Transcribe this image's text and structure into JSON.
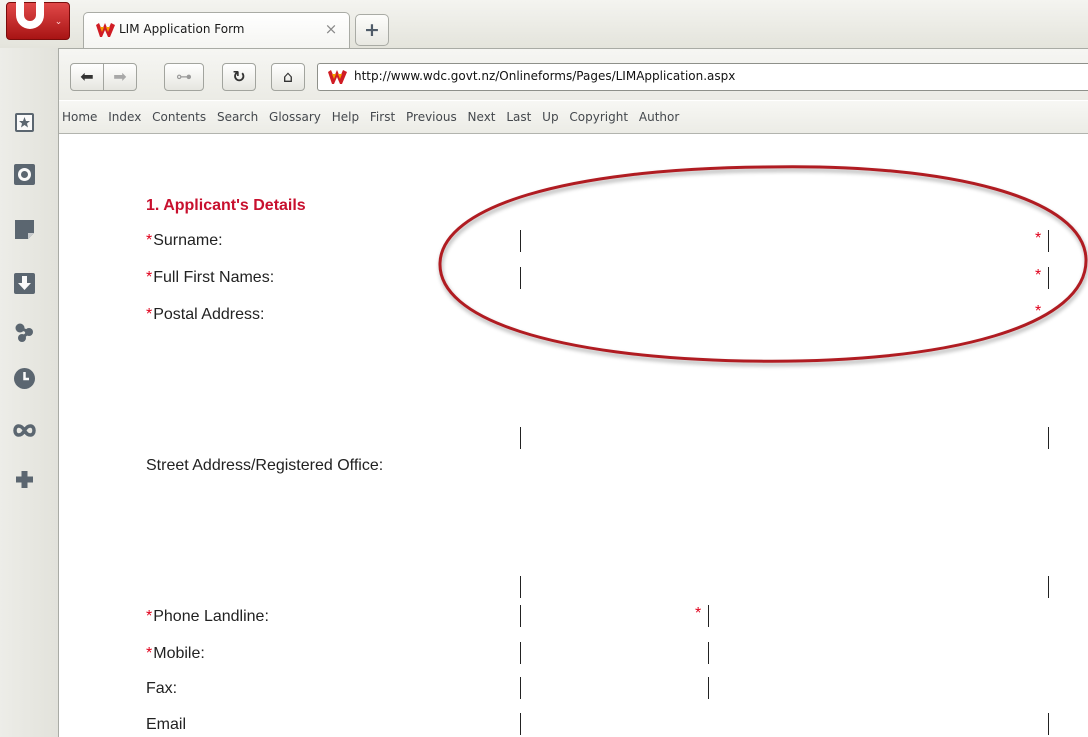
{
  "browser": {
    "tab": {
      "title": "LIM Application Form",
      "close_glyph": "×"
    },
    "new_tab_glyph": "+",
    "menu_arrow_glyph": "⌄",
    "address": {
      "url": "http://www.wdc.govt.nz/Onlineforms/Pages/LIMApplication.aspx"
    },
    "nav_buttons": {
      "back_glyph": "⬅",
      "forward_glyph": "➡",
      "password_glyph": "⊶",
      "reload_glyph": "↻",
      "home_glyph": "⌂"
    },
    "nav_links": [
      "Home",
      "Index",
      "Contents",
      "Search",
      "Glossary",
      "Help",
      "First",
      "Previous",
      "Next",
      "Last",
      "Up",
      "Copyright",
      "Author"
    ],
    "side_icons": [
      "bookmarks-icon",
      "widgets-icon",
      "notes-icon",
      "downloads-icon",
      "links-icon",
      "history-icon",
      "unite-icon",
      "add-panel-icon"
    ]
  },
  "form": {
    "section_title": "1. Applicant's Details",
    "required_marker": "*",
    "fields": {
      "surname": "Surname:",
      "first_names": "Full First Names:",
      "postal_address": "Postal Address:",
      "street_address": "Street Address/Registered Office:",
      "phone_landline": "Phone Landline:",
      "mobile": "Mobile:",
      "fax": "Fax:",
      "email": "Email"
    }
  },
  "colors": {
    "required": "#e0001b",
    "section_title": "#c8102e",
    "annotation": "#b01e24",
    "opera_red": "#cc1f1f"
  }
}
